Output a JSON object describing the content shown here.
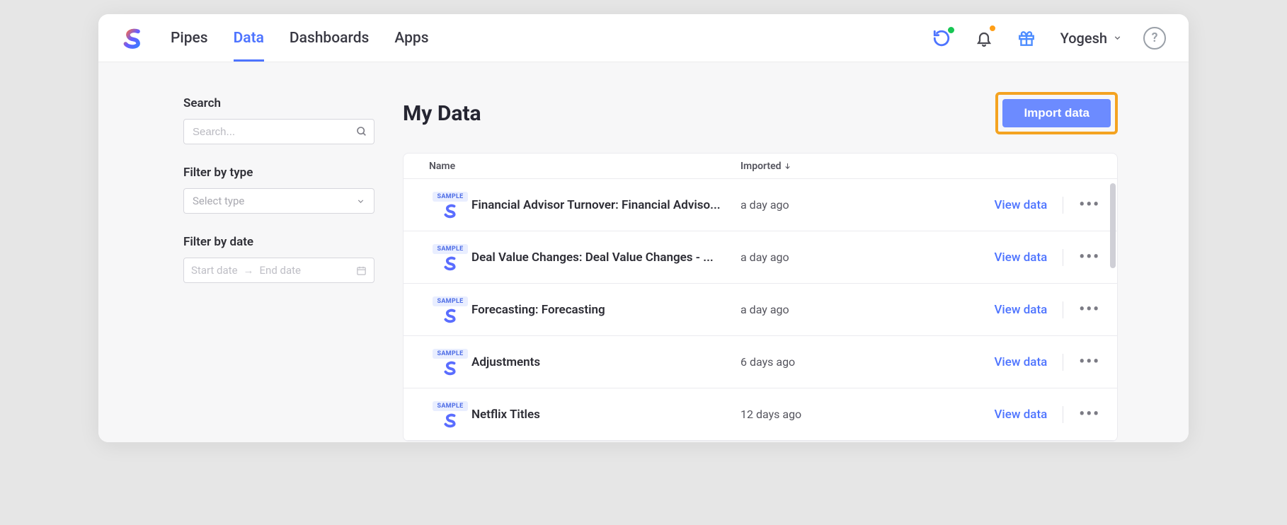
{
  "nav": {
    "pipes": "Pipes",
    "data": "Data",
    "dashboards": "Dashboards",
    "apps": "Apps"
  },
  "user": {
    "name": "Yogesh"
  },
  "sidebar": {
    "search_label": "Search",
    "search_placeholder": "Search...",
    "type_label": "Filter by type",
    "type_placeholder": "Select type",
    "date_label": "Filter by date",
    "start_placeholder": "Start date",
    "end_placeholder": "End date"
  },
  "main": {
    "title": "My Data",
    "import_label": "Import data",
    "col_name": "Name",
    "col_imported": "Imported",
    "view_label": "View data"
  },
  "rows": [
    {
      "name": "Financial Advisor Turnover: Financial Adviso...",
      "imported": "a day ago"
    },
    {
      "name": "Deal Value Changes: Deal Value Changes - ...",
      "imported": "a day ago"
    },
    {
      "name": "Forecasting: Forecasting",
      "imported": "a day ago"
    },
    {
      "name": "Adjustments",
      "imported": "6 days ago"
    },
    {
      "name": "Netflix Titles",
      "imported": "12 days ago"
    }
  ],
  "badge": {
    "sample": "SAMPLE"
  }
}
